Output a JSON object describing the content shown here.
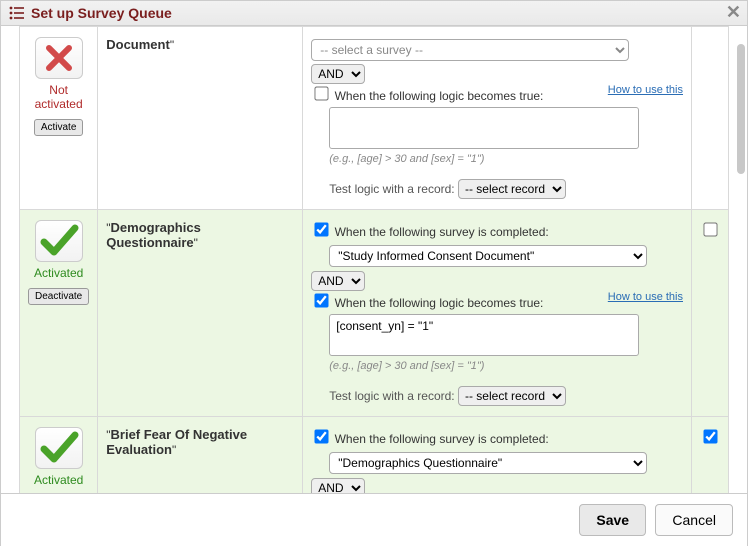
{
  "header": {
    "title": "Set up Survey Queue"
  },
  "common": {
    "when_survey_completed": "When the following survey is completed:",
    "when_logic_true": "When the following logic becomes true:",
    "how_to_use": "How to use this",
    "hint_example": "(e.g., [age] > 30 and [sex] = \"1\")",
    "test_logic_label": "Test logic with a record:",
    "select_record": "-- select record --",
    "and_label": "AND"
  },
  "status": {
    "activated": "Activated",
    "not_activated": "Not activated",
    "not_line1": "Not",
    "not_line2": "activated",
    "activate_btn": "Activate",
    "deactivate_btn": "Deactivate"
  },
  "rows": [
    {
      "name_partial": "Document",
      "survey_select_placeholder": "-- select a survey --",
      "logic_value": ""
    },
    {
      "name": "Demographics Questionnaire",
      "survey_selected": "\"Study Informed Consent Document\"",
      "logic_value": "[consent_yn] = \"1\""
    },
    {
      "name": "Brief Fear Of Negative Evaluation",
      "survey_selected": "\"Demographics Questionnaire\"",
      "logic_value": ""
    }
  ],
  "footer": {
    "save": "Save",
    "cancel": "Cancel"
  }
}
